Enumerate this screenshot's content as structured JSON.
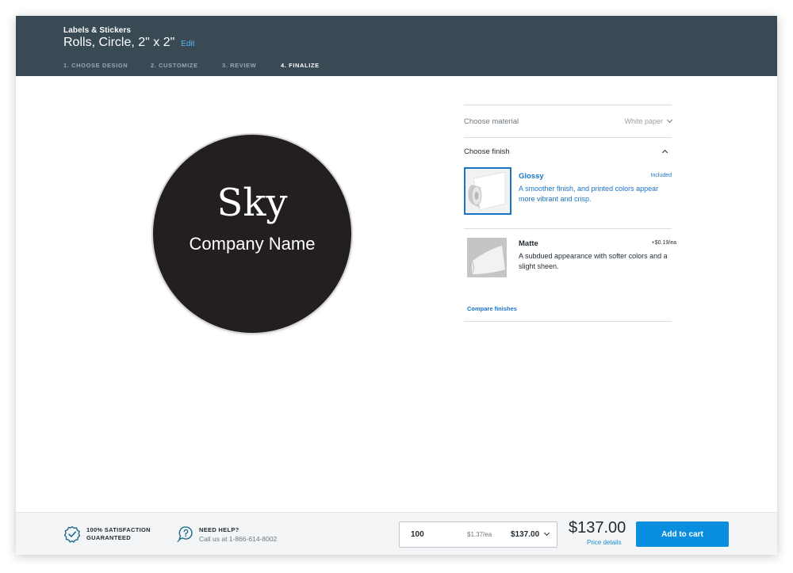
{
  "header": {
    "category": "Labels & Stickers",
    "product_title": "Rolls, Circle, 2\" x 2\"",
    "edit_label": "Edit",
    "steps": [
      {
        "label": "1. CHOOSE DESIGN",
        "active": false
      },
      {
        "label": "2. CUSTOMIZE",
        "active": false
      },
      {
        "label": "3. REVIEW",
        "active": false
      },
      {
        "label": "4. FINALIZE",
        "active": true
      }
    ]
  },
  "preview": {
    "line1": "Sky",
    "line2": "Company Name",
    "label_color": "#231f20"
  },
  "options": {
    "material": {
      "label": "Choose material",
      "value": "White paper"
    },
    "finish": {
      "label": "Choose finish",
      "items": [
        {
          "name": "Glossy",
          "price": "Included",
          "description": "A smoother finish, and printed colors appear more vibrant and crisp.",
          "selected": true
        },
        {
          "name": "Matte",
          "price": "+$0.19/ea",
          "description": "A subdued appearance with softer colors and a slight sheen.",
          "selected": false
        }
      ],
      "compare_label": "Compare finishes"
    }
  },
  "footer": {
    "guarantee_line1": "100% SATISFACTION",
    "guarantee_line2": "GUARANTEED",
    "help_title": "NEED HELP?",
    "help_text": "Call us at 1-866-614-8002",
    "quantity": "100",
    "unit_price": "$1.37/ea",
    "subtotal": "$137.00",
    "total": "$137.00",
    "price_details_label": "Price details",
    "add_to_cart_label": "Add to cart"
  },
  "colors": {
    "header_bg": "#3a4a55",
    "accent": "#1a73c7",
    "cta": "#0a8fe0",
    "footer_bg": "#f4f5f6"
  },
  "icons": [
    "chevron-down-icon",
    "chevron-up-icon",
    "badge-check-icon",
    "help-bubble-icon"
  ]
}
